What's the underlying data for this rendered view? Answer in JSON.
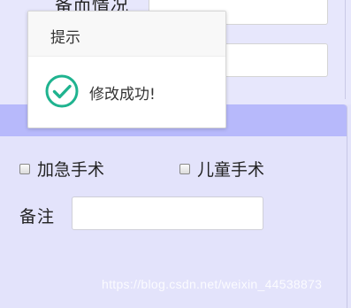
{
  "form_top": {
    "partial_label": "备而情况"
  },
  "checkboxes": [
    {
      "label": "加急手术",
      "checked": false
    },
    {
      "label": "儿童手术",
      "checked": false
    }
  ],
  "remark": {
    "label": "备注",
    "value": ""
  },
  "modal": {
    "title": "提示",
    "message": "修改成功!",
    "icon": "success-check-icon",
    "icon_color": "#1fb38f"
  },
  "watermark": "https://blog.csdn.net/weixin_44538873",
  "colors": {
    "page_background": "#e3e3fb",
    "panel_header": "#b7b9fb"
  }
}
